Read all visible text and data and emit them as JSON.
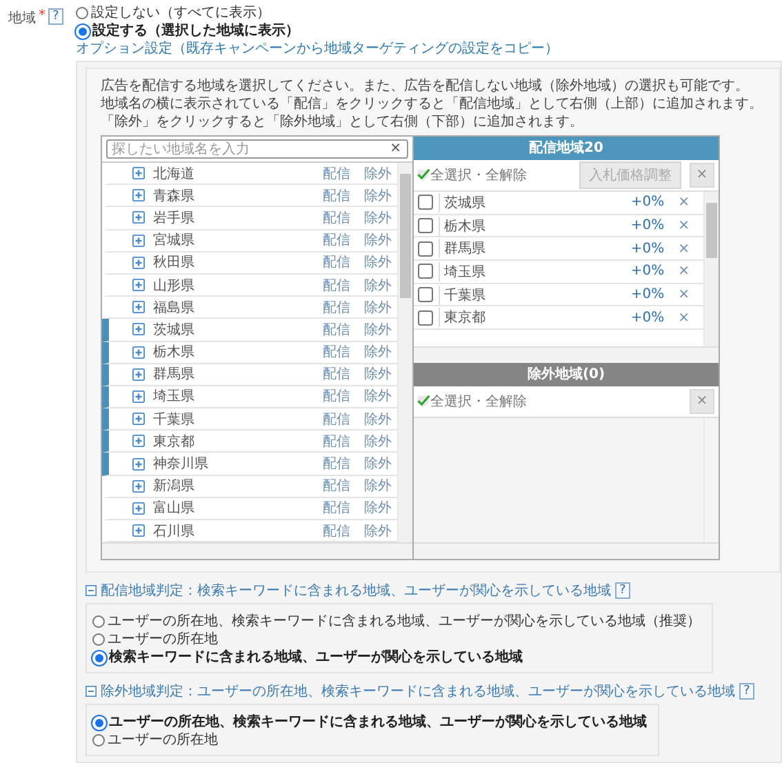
{
  "field": {
    "label": "地域",
    "required_mark": "*",
    "help": "?"
  },
  "targeting_options": [
    {
      "label": "設定しない（すべてに表示）",
      "selected": false
    },
    {
      "label": "設定する（選択した地域に表示）",
      "selected": true
    }
  ],
  "copy_link": "オプション設定（既存キャンペーンから地域ターゲティングの設定をコピー）",
  "instructions": [
    "広告を配信する地域を選択してください。また、広告を配信しない地域（除外地域）の選択も可能です。",
    "地域名の横に表示されている「配信」をクリックすると「配信地域」として右側（上部）に追加されます。",
    "「除外」をクリックすると「除外地域」として右側（下部）に追加されます。"
  ],
  "search": {
    "placeholder": "探したい地域名を入力",
    "clear": "×"
  },
  "regions": [
    {
      "name": "北海道",
      "selected": false,
      "deliver": "配信",
      "exclude": "除外"
    },
    {
      "name": "青森県",
      "selected": false,
      "deliver": "配信",
      "exclude": "除外"
    },
    {
      "name": "岩手県",
      "selected": false,
      "deliver": "配信",
      "exclude": "除外"
    },
    {
      "name": "宮城県",
      "selected": false,
      "deliver": "配信",
      "exclude": "除外"
    },
    {
      "name": "秋田県",
      "selected": false,
      "deliver": "配信",
      "exclude": "除外"
    },
    {
      "name": "山形県",
      "selected": false,
      "deliver": "配信",
      "exclude": "除外"
    },
    {
      "name": "福島県",
      "selected": false,
      "deliver": "配信",
      "exclude": "除外"
    },
    {
      "name": "茨城県",
      "selected": true,
      "deliver": "配信",
      "exclude": "除外"
    },
    {
      "name": "栃木県",
      "selected": true,
      "deliver": "配信",
      "exclude": "除外"
    },
    {
      "name": "群馬県",
      "selected": true,
      "deliver": "配信",
      "exclude": "除外"
    },
    {
      "name": "埼玉県",
      "selected": true,
      "deliver": "配信",
      "exclude": "除外"
    },
    {
      "name": "千葉県",
      "selected": true,
      "deliver": "配信",
      "exclude": "除外"
    },
    {
      "name": "東京都",
      "selected": true,
      "deliver": "配信",
      "exclude": "除外"
    },
    {
      "name": "神奈川県",
      "selected": true,
      "deliver": "配信",
      "exclude": "除外"
    },
    {
      "name": "新潟県",
      "selected": false,
      "deliver": "配信",
      "exclude": "除外"
    },
    {
      "name": "富山県",
      "selected": false,
      "deliver": "配信",
      "exclude": "除外"
    },
    {
      "name": "石川県",
      "selected": false,
      "deliver": "配信",
      "exclude": "除外"
    }
  ],
  "delivery_panel": {
    "title": "配信地域20",
    "select_all": "全選択・全解除",
    "bid_button": {
      "label": "入札価格調整",
      "disabled": true
    },
    "remove_button": "×",
    "items": [
      {
        "name": "茨城県",
        "checked": false,
        "bid": "+0%",
        "remove": "×"
      },
      {
        "name": "栃木県",
        "checked": false,
        "bid": "+0%",
        "remove": "×"
      },
      {
        "name": "群馬県",
        "checked": false,
        "bid": "+0%",
        "remove": "×"
      },
      {
        "name": "埼玉県",
        "checked": false,
        "bid": "+0%",
        "remove": "×"
      },
      {
        "name": "千葉県",
        "checked": false,
        "bid": "+0%",
        "remove": "×"
      },
      {
        "name": "東京都",
        "checked": false,
        "bid": "+0%",
        "remove": "×"
      }
    ]
  },
  "excluded_panel": {
    "title": "除外地域(0)",
    "select_all": "全選択・全解除",
    "remove_button": "×"
  },
  "sections": [
    {
      "title": "配信地域判定：検索キーワードに含まれる地域、ユーザーが関心を示している地域",
      "expanded": true,
      "help": "?",
      "options": [
        {
          "label": "ユーザーの所在地、検索キーワードに含まれる地域、ユーザーが関心を示している地域（推奨）",
          "selected": false
        },
        {
          "label": "ユーザーの所在地",
          "selected": false
        },
        {
          "label": "検索キーワードに含まれる地域、ユーザーが関心を示している地域",
          "selected": true
        }
      ]
    },
    {
      "title": "除外地域判定：ユーザーの所在地、検索キーワードに含まれる地域、ユーザーが関心を示している地域",
      "expanded": true,
      "help": "?",
      "options": [
        {
          "label": "ユーザーの所在地、検索キーワードに含まれる地域、ユーザーが関心を示している地域",
          "selected": true
        },
        {
          "label": "ユーザーの所在地",
          "selected": false
        }
      ]
    }
  ]
}
